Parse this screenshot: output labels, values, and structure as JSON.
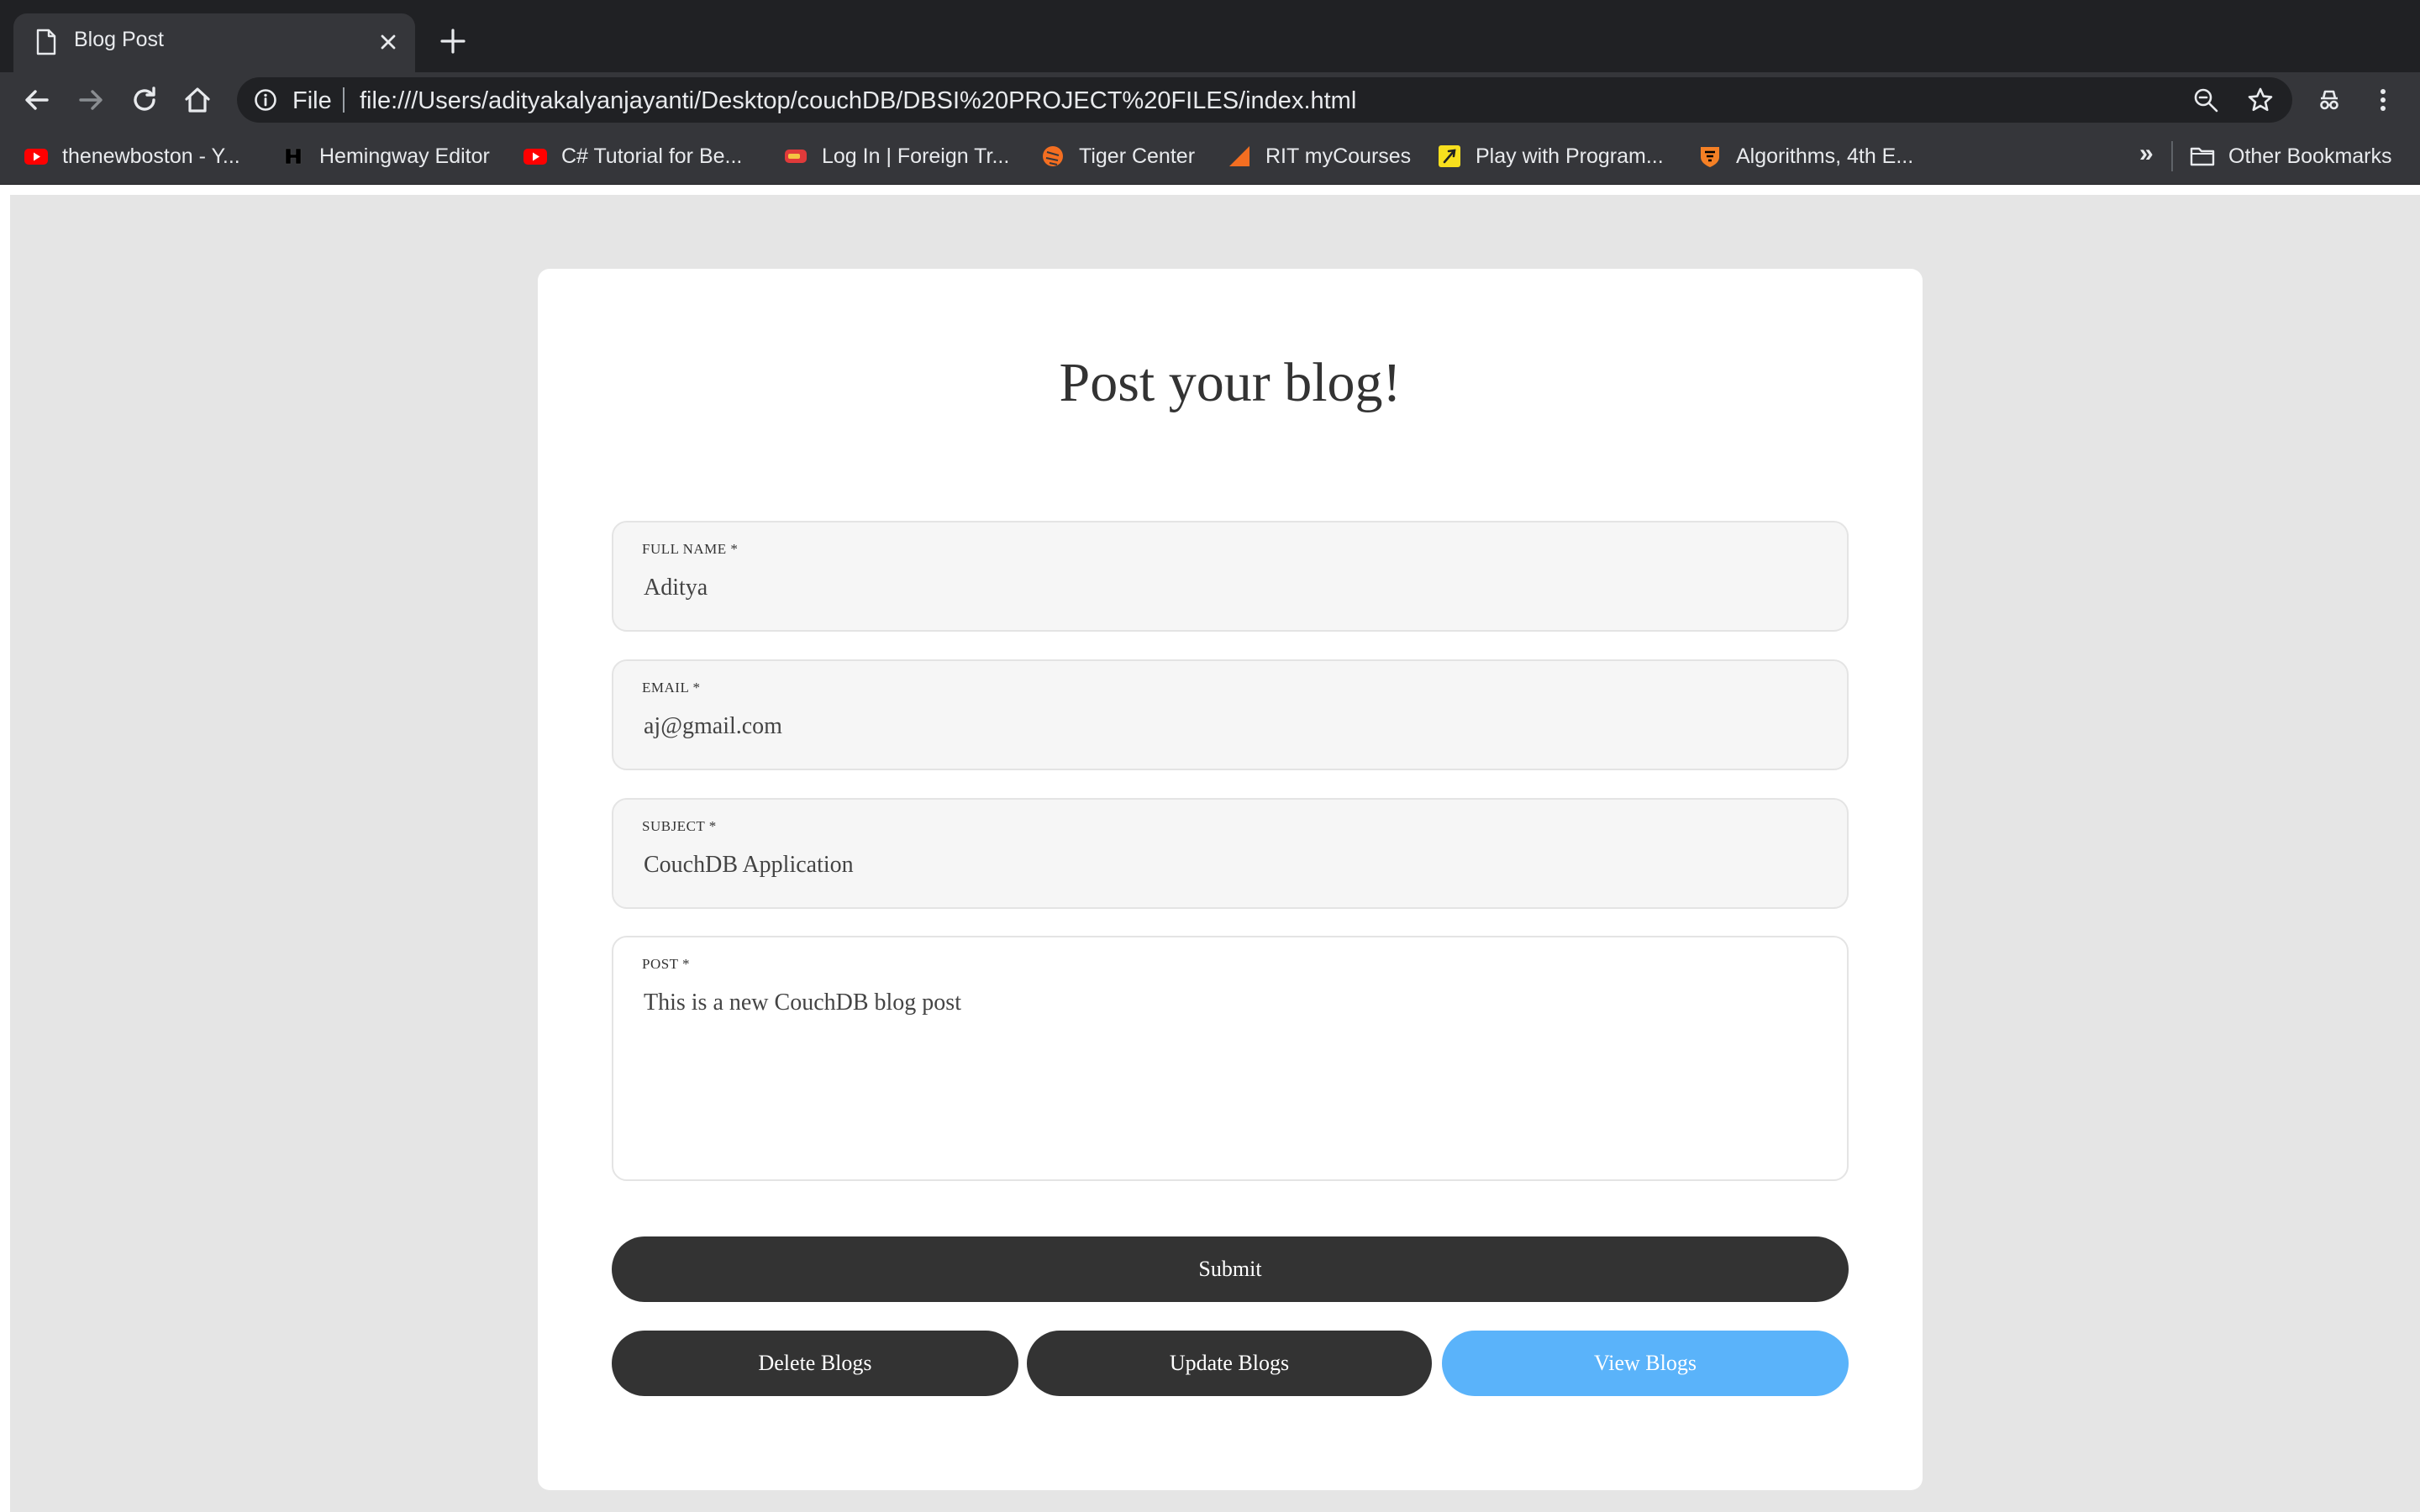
{
  "browser": {
    "tab_title": "Blog Post",
    "omnibox": {
      "scheme": "File",
      "url": "file:///Users/adityakalyanjayanti/Desktop/couchDB/DBSI%20PROJECT%20FILES/index.html"
    },
    "bookmarks": [
      {
        "label": "thenewboston - Y...",
        "icon": "youtube-icon"
      },
      {
        "label": "Hemingway Editor",
        "icon": "hemingway-icon"
      },
      {
        "label": "C# Tutorial for Be...",
        "icon": "youtube-icon"
      },
      {
        "label": "Log In | Foreign Tr...",
        "icon": "flag-icon"
      },
      {
        "label": "Tiger Center",
        "icon": "tiger-icon"
      },
      {
        "label": "RIT myCourses",
        "icon": "mycourses-icon"
      },
      {
        "label": "Play with Program...",
        "icon": "program-icon"
      },
      {
        "label": "Algorithms, 4th E...",
        "icon": "princeton-icon"
      }
    ],
    "overflow_label": "»",
    "other_bookmarks": "Other Bookmarks"
  },
  "page": {
    "heading": "Post your blog!",
    "fields": {
      "full_name": {
        "label": "FULL NAME *",
        "value": "Aditya"
      },
      "email": {
        "label": "EMAIL *",
        "value": "aj@gmail.com"
      },
      "subject": {
        "label": "SUBJECT *",
        "value": "CouchDB Application"
      },
      "post": {
        "label": "POST *",
        "value": "This is a new CouchDB blog post"
      }
    },
    "buttons": {
      "submit": "Submit",
      "delete": "Delete Blogs",
      "update": "Update Blogs",
      "view": "View Blogs"
    }
  },
  "colors": {
    "chrome_dark": "#202124",
    "chrome_toolbar": "#35363a",
    "page_background": "#e5e5e5",
    "button_dark": "#333333",
    "button_accent": "#5ab3fa"
  }
}
